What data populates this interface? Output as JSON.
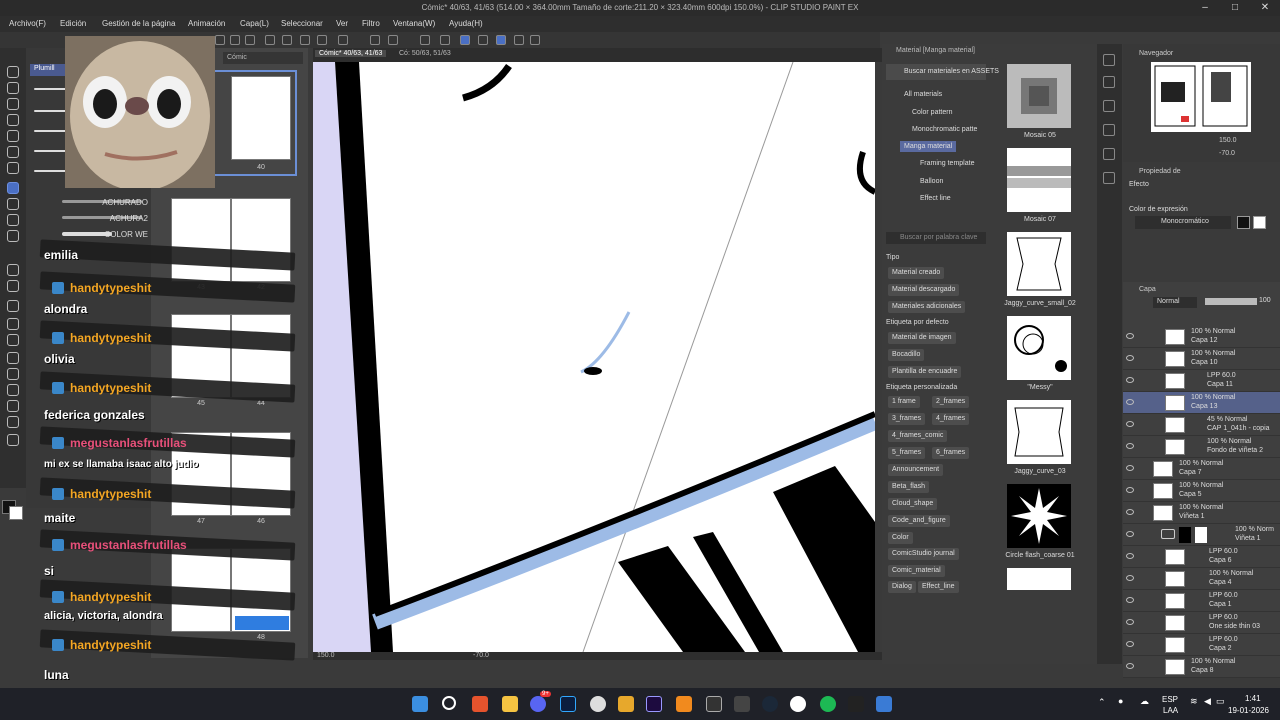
{
  "window": {
    "title": "Cómic* 40/63, 41/63 (514.00 × 364.00mm Tamaño de corte:211.20 × 323.40mm 600dpi 150.0%) - CLIP STUDIO PAINT EX"
  },
  "menu": [
    "Archivo(F)",
    "Edición",
    "Gestión de la página",
    "Animación",
    "Capa(L)",
    "Seleccionar",
    "Ver",
    "Filtro",
    "Ventana(W)",
    "Ayuda(H)"
  ],
  "subtool": {
    "tab_label": "Plumill",
    "brushes": [
      "ACHURADO",
      "ACHURA2",
      "COLOR WE"
    ]
  },
  "page_manager": {
    "tab_label": "Cómic",
    "pages": [
      "40",
      "43",
      "42",
      "45",
      "44",
      "47",
      "46",
      "48"
    ]
  },
  "canvas": {
    "tabs": [
      "Cómic* 40/63, 41/63",
      "Có: 50/63, 51/63"
    ],
    "zoom": "150.0",
    "rotation": "-70.0"
  },
  "chat": [
    {
      "kind": "msg",
      "text": "emilia"
    },
    {
      "kind": "user",
      "text": "handytypeshit"
    },
    {
      "kind": "msg",
      "text": "alondra"
    },
    {
      "kind": "user",
      "text": "handytypeshit"
    },
    {
      "kind": "msg",
      "text": "olivia"
    },
    {
      "kind": "user",
      "text": "handytypeshit"
    },
    {
      "kind": "msg",
      "text": "federica gonzales"
    },
    {
      "kind": "user-pink",
      "text": "megustanlasfrutillas"
    },
    {
      "kind": "msg",
      "text": "mi ex se llamaba isaac alto judio"
    },
    {
      "kind": "user",
      "text": "handytypeshit"
    },
    {
      "kind": "msg",
      "text": "maite"
    },
    {
      "kind": "user-pink",
      "text": "megustanlasfrutillas"
    },
    {
      "kind": "msg",
      "text": "si"
    },
    {
      "kind": "user",
      "text": "handytypeshit"
    },
    {
      "kind": "msg",
      "text": "alicia, victoria, alondra"
    },
    {
      "kind": "user",
      "text": "handytypeshit"
    },
    {
      "kind": "msg",
      "text": "luna"
    }
  ],
  "material": {
    "panel_title": "Material [Manga material]",
    "search_assets": "Buscar materiales en ASSETS",
    "tree": [
      "All materials",
      "Color pattern",
      "Monochromatic patte",
      "Manga material",
      "Framing template",
      "Balloon",
      "Effect line"
    ],
    "search_placeholder": "Buscar por palabra clave",
    "tipo_label": "Tipo",
    "tipo": [
      "Material creado",
      "Material descargado",
      "Materiales adicionales"
    ],
    "default_tag_label": "Etiqueta por defecto",
    "default_tags": [
      "Material de imagen",
      "Bocadillo",
      "Plantilla de encuadre"
    ],
    "custom_tag_label": "Etiqueta personalizada",
    "custom_tags": [
      "1 frame",
      "2_frames",
      "3_frames",
      "4_frames",
      "4_frames_comic",
      "5_frames",
      "6_frames",
      "Announcement",
      "Beta_flash",
      "Cloud_shape",
      "Code_and_figure",
      "Color",
      "ComicStudio journal",
      "Comic_material",
      "Dialog",
      "Effect_line"
    ],
    "items": [
      "Mosaic 05",
      "Mosaic 07",
      "Jaggy_curve_small_02",
      "\"Messy\"",
      "Jaggy_curve_03",
      "Circle flash_coarse 01"
    ]
  },
  "navigator": {
    "title": "Navegador",
    "zoom": "150.0",
    "rotation": "-70.0"
  },
  "layer_property": {
    "title": "Propiedad de",
    "effect_label": "Efecto",
    "expression_label": "Color de expresión",
    "expression_value": "Monocromático"
  },
  "layers": {
    "title": "Capa",
    "blend": "Normal",
    "opacity": "100",
    "rows": [
      {
        "mode": "100 % Normal",
        "name": "Capa 12"
      },
      {
        "mode": "100 % Normal",
        "name": "Capa 10"
      },
      {
        "mode": "LPP 60.0",
        "name": "Capa 11"
      },
      {
        "mode": "100 % Normal",
        "name": "Capa 13"
      },
      {
        "mode": "45 % Normal",
        "name": "CAP 1_041h - copia"
      },
      {
        "mode": "100 % Normal",
        "name": "Fondo de viñeta 2"
      },
      {
        "mode": "100 % Normal",
        "name": "Capa 7"
      },
      {
        "mode": "100 % Normal",
        "name": "Capa 5"
      },
      {
        "mode": "100 % Normal",
        "name": "Viñeta 1"
      },
      {
        "mode": "100 % Norm",
        "name": "Viñeta 1"
      },
      {
        "mode": "LPP 60.0",
        "name": "Capa 6"
      },
      {
        "mode": "100 % Normal",
        "name": "Capa 4"
      },
      {
        "mode": "LPP 60.0",
        "name": "Capa 1"
      },
      {
        "mode": "LPP 60.0",
        "name": "One side thin 03"
      },
      {
        "mode": "LPP 60.0",
        "name": "Capa 2"
      },
      {
        "mode": "100 % Normal",
        "name": "Capa 8"
      }
    ]
  },
  "taskbar": {
    "lang1": "ESP",
    "lang2": "LAA",
    "time": "1:41",
    "date": "19-01-2026",
    "badge": "9+"
  }
}
